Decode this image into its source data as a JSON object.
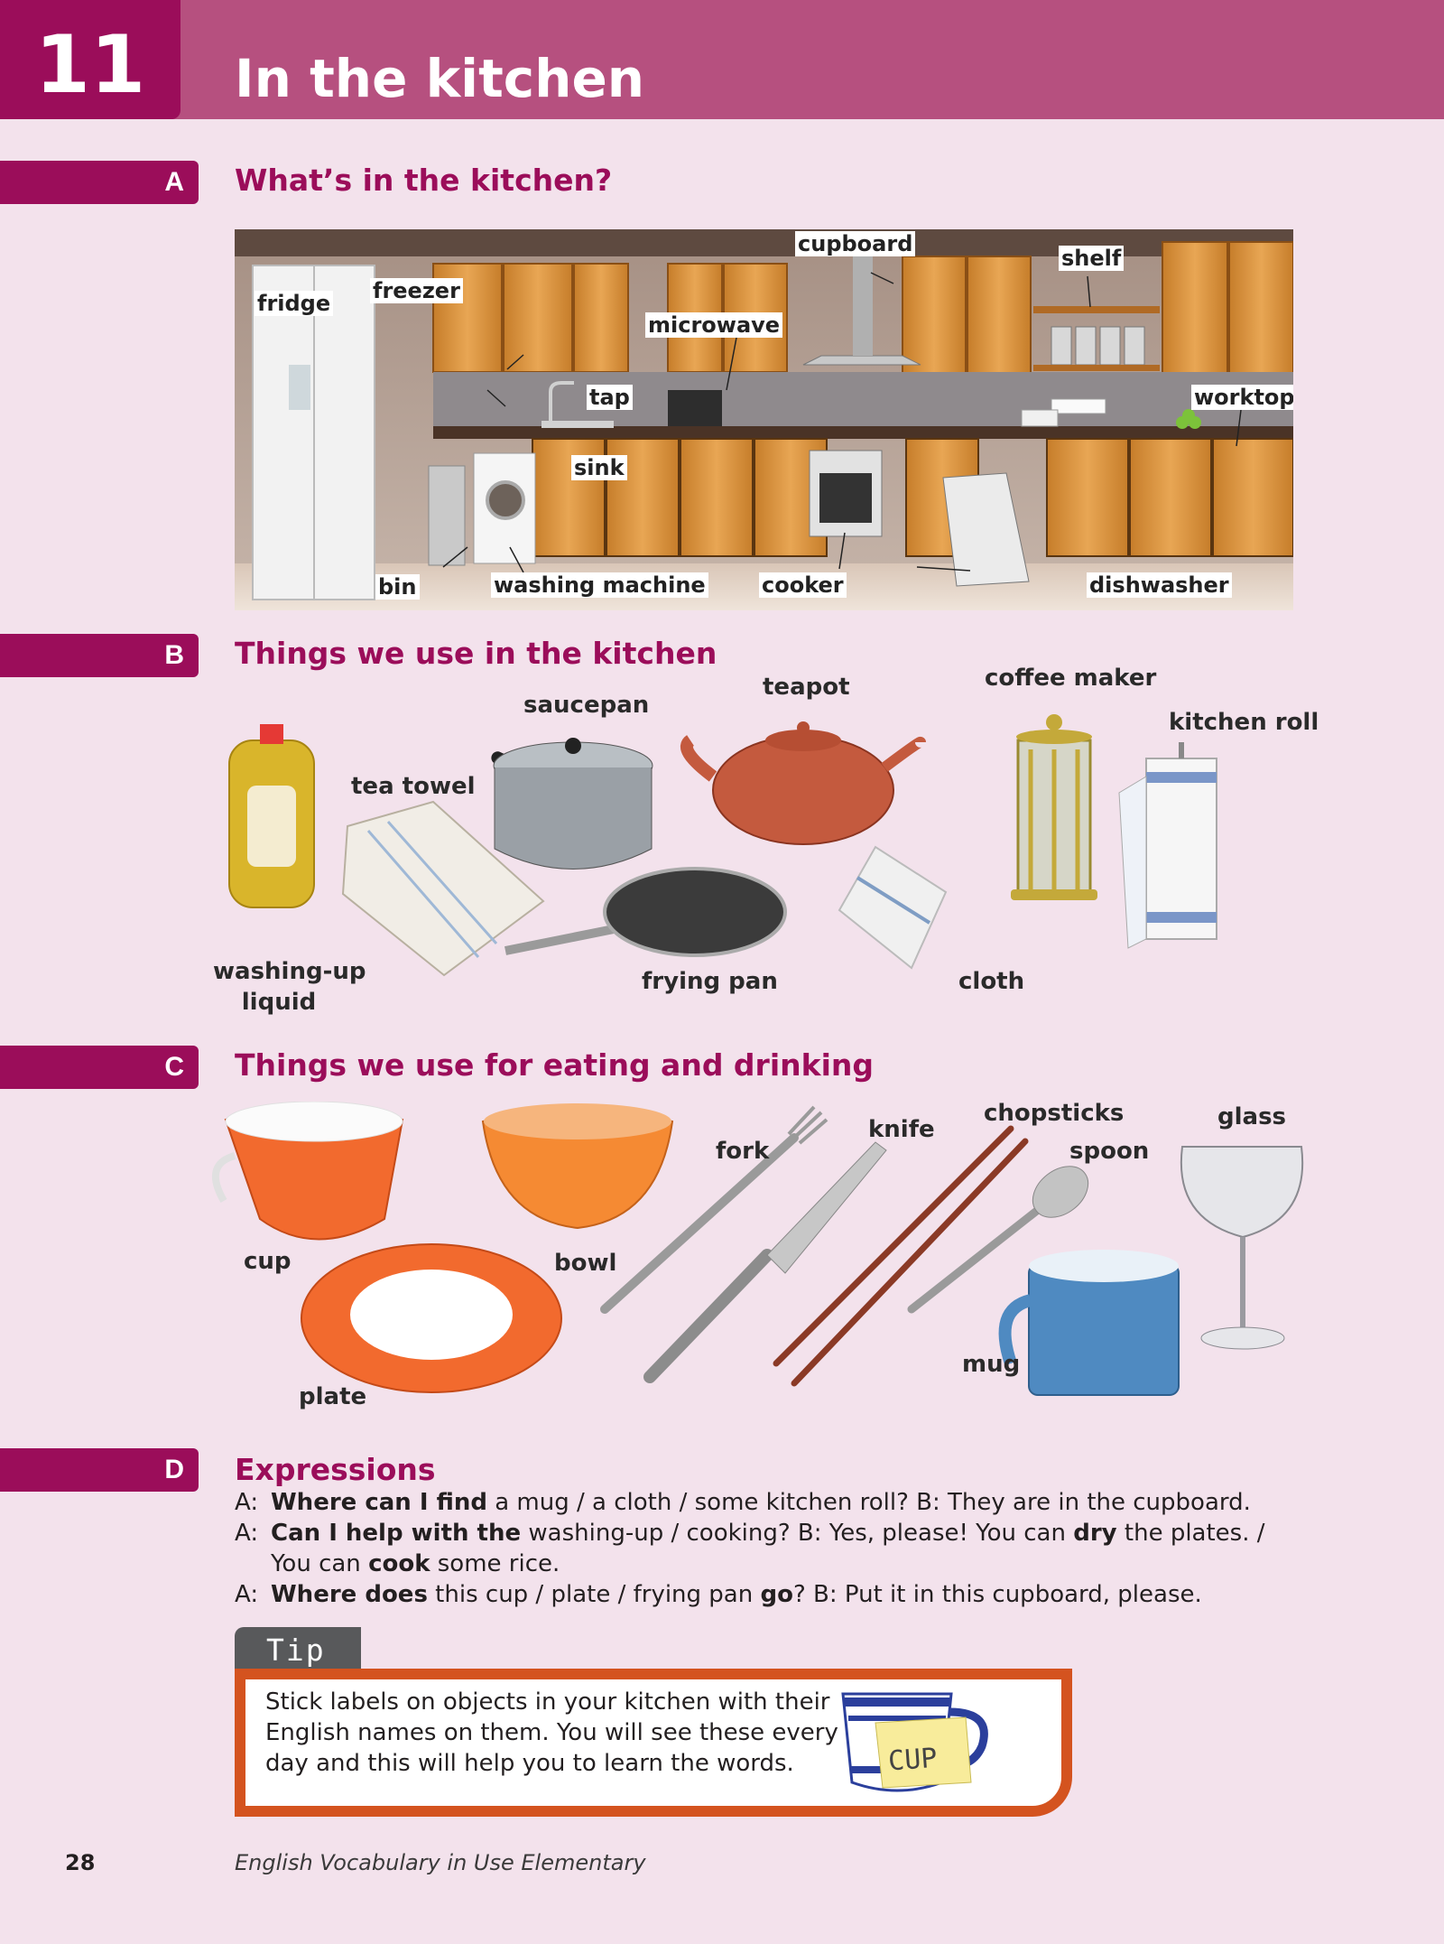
{
  "unit": {
    "number": "11",
    "title": "In the kitchen"
  },
  "sections": {
    "a": {
      "letter": "A",
      "title": "What’s in the kitchen?"
    },
    "b": {
      "letter": "B",
      "title": "Things we use in the kitchen"
    },
    "c": {
      "letter": "C",
      "title": "Things we use for eating and drinking"
    },
    "d": {
      "letter": "D",
      "title": "Expressions"
    }
  },
  "kitchen_labels": {
    "fridge": "fridge",
    "freezer": "freezer",
    "cupboard": "cupboard",
    "shelf": "shelf",
    "microwave": "microwave",
    "tap": "tap",
    "worktop": "worktop",
    "sink": "sink",
    "bin": "bin",
    "washing_machine": "washing machine",
    "cooker": "cooker",
    "dishwasher": "dishwasher"
  },
  "kitchen_things": {
    "saucepan": "saucepan",
    "teapot": "teapot",
    "coffee_maker": "coffee maker",
    "kitchen_roll": "kitchen roll",
    "tea_towel": "tea towel",
    "washing_up_1": "washing-up",
    "washing_up_2": "liquid",
    "frying_pan": "frying pan",
    "cloth": "cloth"
  },
  "eating_things": {
    "chopsticks": "chopsticks",
    "glass": "glass",
    "knife": "knife",
    "fork": "fork",
    "spoon": "spoon",
    "cup": "cup",
    "bowl": "bowl",
    "mug": "mug",
    "plate": "plate"
  },
  "expressions": {
    "line1": {
      "a": "A:",
      "b1": "Where can I find",
      "t1": " a mug / a cloth / some kitchen roll? B: They are in the cupboard."
    },
    "line2": {
      "a": "A:",
      "b1": "Can I help with the",
      "t1": " washing-up / cooking? B: Yes, please! You can ",
      "b2": "dry",
      "t2": " the plates. /"
    },
    "line3": {
      "t1": "You can ",
      "b1": "cook",
      "t2": " some rice."
    },
    "line4": {
      "a": "A:",
      "b1": "Where does",
      "t1": " this cup / plate / frying pan ",
      "b2": "go",
      "t2": "? B: Put it in this cupboard, please."
    }
  },
  "tip": {
    "heading": "Tip",
    "line1": "Stick labels on objects in your kitchen with their",
    "line2": "English names on them. You will see these every",
    "line3": "day and this will help you to learn the words.",
    "sticker": "CUP"
  },
  "footer": {
    "page": "28",
    "book": "English Vocabulary in Use Elementary"
  },
  "colors": {
    "header": "#b6507f",
    "accent": "#9b0d5a",
    "page_bg": "#f3e2ec",
    "tip_border": "#d4531f"
  }
}
